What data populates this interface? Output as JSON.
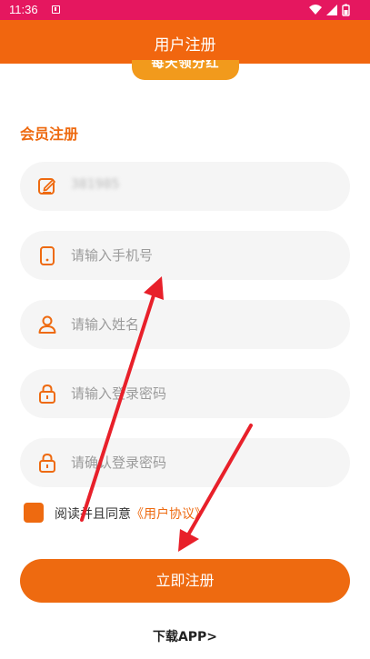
{
  "status_bar": {
    "time": "11:36",
    "icons": [
      "wifi-icon",
      "signal-icon",
      "battery-icon"
    ]
  },
  "header": {
    "title": "用户注册"
  },
  "banner": {
    "text": "每天领分红"
  },
  "form": {
    "section_title": "会员注册",
    "invite_code_value": "381985",
    "phone_placeholder": "请输入手机号",
    "name_placeholder": "请输入姓名",
    "password_placeholder": "请输入登录密码",
    "confirm_password_placeholder": "请确认登录密码"
  },
  "agreement": {
    "text": "阅读并且同意",
    "link": "《用户协议》",
    "checked": true
  },
  "submit_label": "立即注册",
  "download_link": "下载APP>",
  "colors": {
    "accent": "#ee6a10",
    "status_bar": "#e5175f",
    "annotation_arrow": "#e8202a"
  }
}
